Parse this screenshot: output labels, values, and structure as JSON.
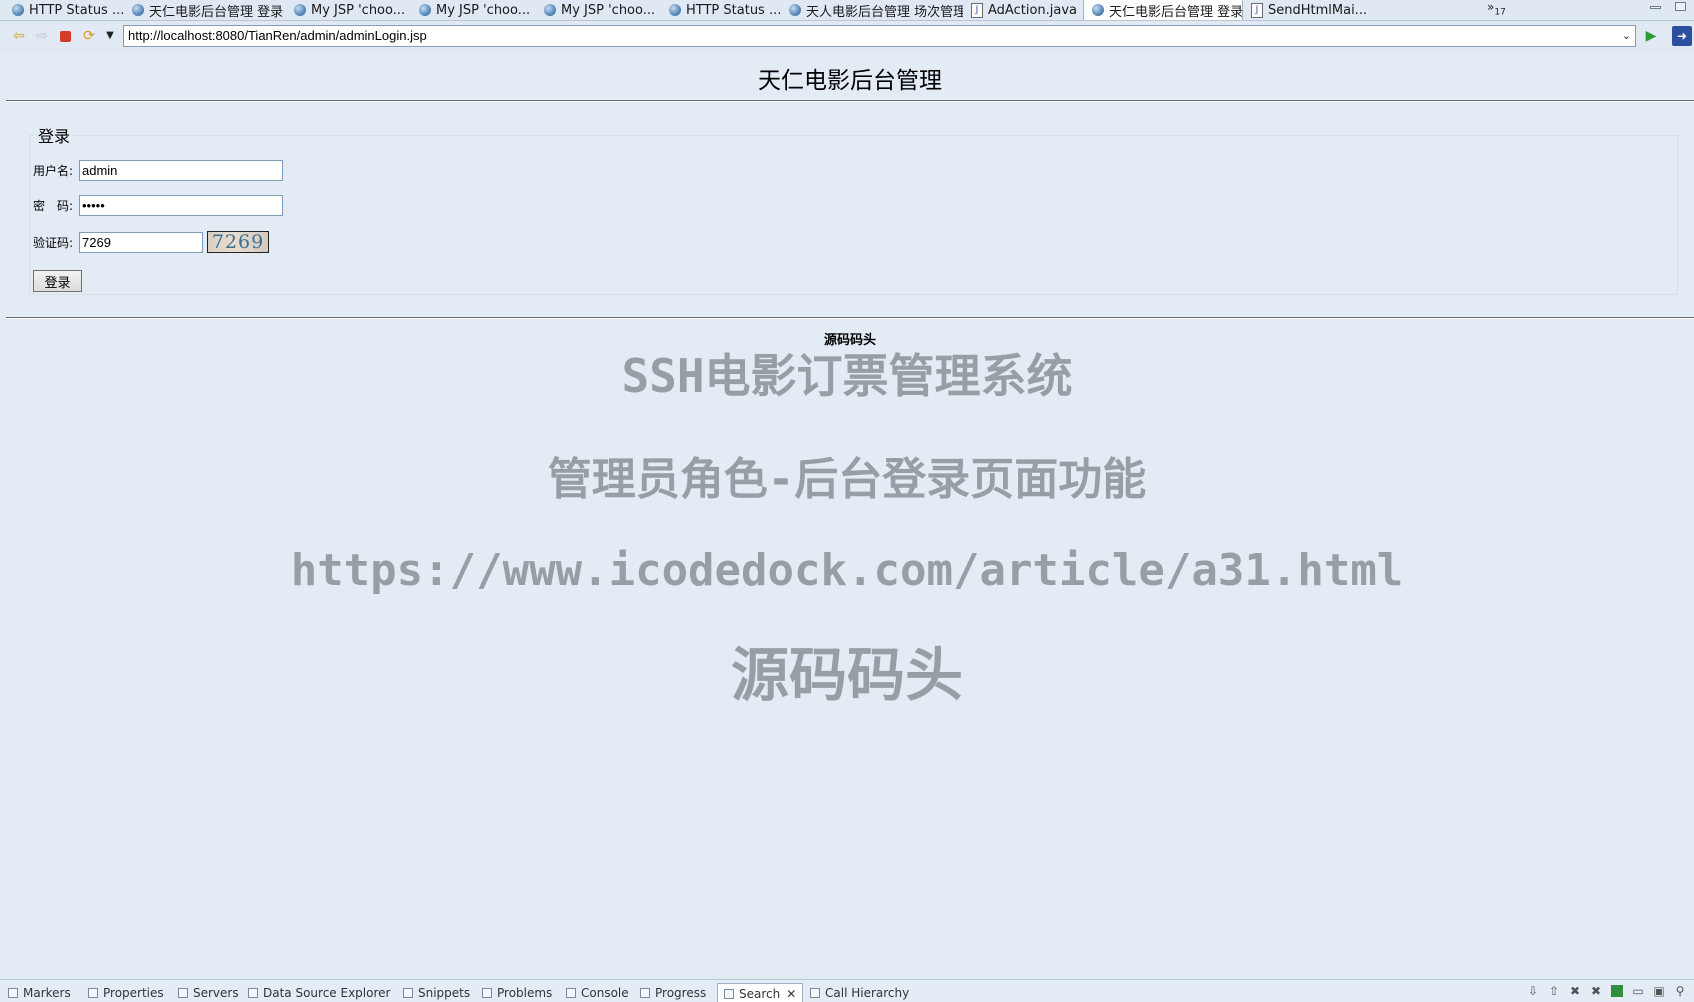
{
  "tabs": [
    {
      "label": "HTTP Status ...",
      "icon": "globe-icon"
    },
    {
      "label": "天仁电影后台管理 登录",
      "icon": "globe-icon"
    },
    {
      "label": "My JSP 'choo...",
      "icon": "globe-icon"
    },
    {
      "label": "My JSP 'choo...",
      "icon": "globe-icon"
    },
    {
      "label": "My JSP 'choo...",
      "icon": "globe-icon"
    },
    {
      "label": "HTTP Status ...",
      "icon": "globe-icon"
    },
    {
      "label": "天人电影后台管理 场次管理",
      "icon": "globe-icon"
    },
    {
      "label": "AdAction.java",
      "icon": "java-file-icon"
    },
    {
      "label": "天仁电影后台管理 登录",
      "icon": "globe-icon",
      "active": true
    },
    {
      "label": "SendHtmlMai...",
      "icon": "java-file-icon"
    }
  ],
  "tab_overflow": {
    "chevron": "»",
    "count": "17"
  },
  "toolbar": {
    "url": "http://localhost:8080/TianRen/admin/adminLogin.jsp"
  },
  "page": {
    "title": "天仁电影后台管理",
    "legend": "登录",
    "username_label": "用户名:",
    "username_value": "admin",
    "password_label": "密　码:",
    "password_value": "admin",
    "captcha_label": "验证码:",
    "captcha_input": "7269",
    "captcha_image": "7269",
    "login_button": "登录",
    "footer": "源码码头"
  },
  "watermark": {
    "line1": "SSH电影订票管理系统",
    "line2": "管理员角色-后台登录页面功能",
    "line3": "https://www.icodedock.com/article/a31.html",
    "line4": "源码码头"
  },
  "bottom_views": [
    {
      "label": "Markers"
    },
    {
      "label": "Properties"
    },
    {
      "label": "Servers"
    },
    {
      "label": "Data Source Explorer"
    },
    {
      "label": "Snippets"
    },
    {
      "label": "Problems"
    },
    {
      "label": "Console"
    },
    {
      "label": "Progress"
    },
    {
      "label": "Search",
      "active": true
    },
    {
      "label": "Call Hierarchy"
    }
  ],
  "colors": {
    "page_background": "#e3ebf5",
    "watermark": "#8f969c",
    "captcha_text": "#3d6f8f"
  }
}
